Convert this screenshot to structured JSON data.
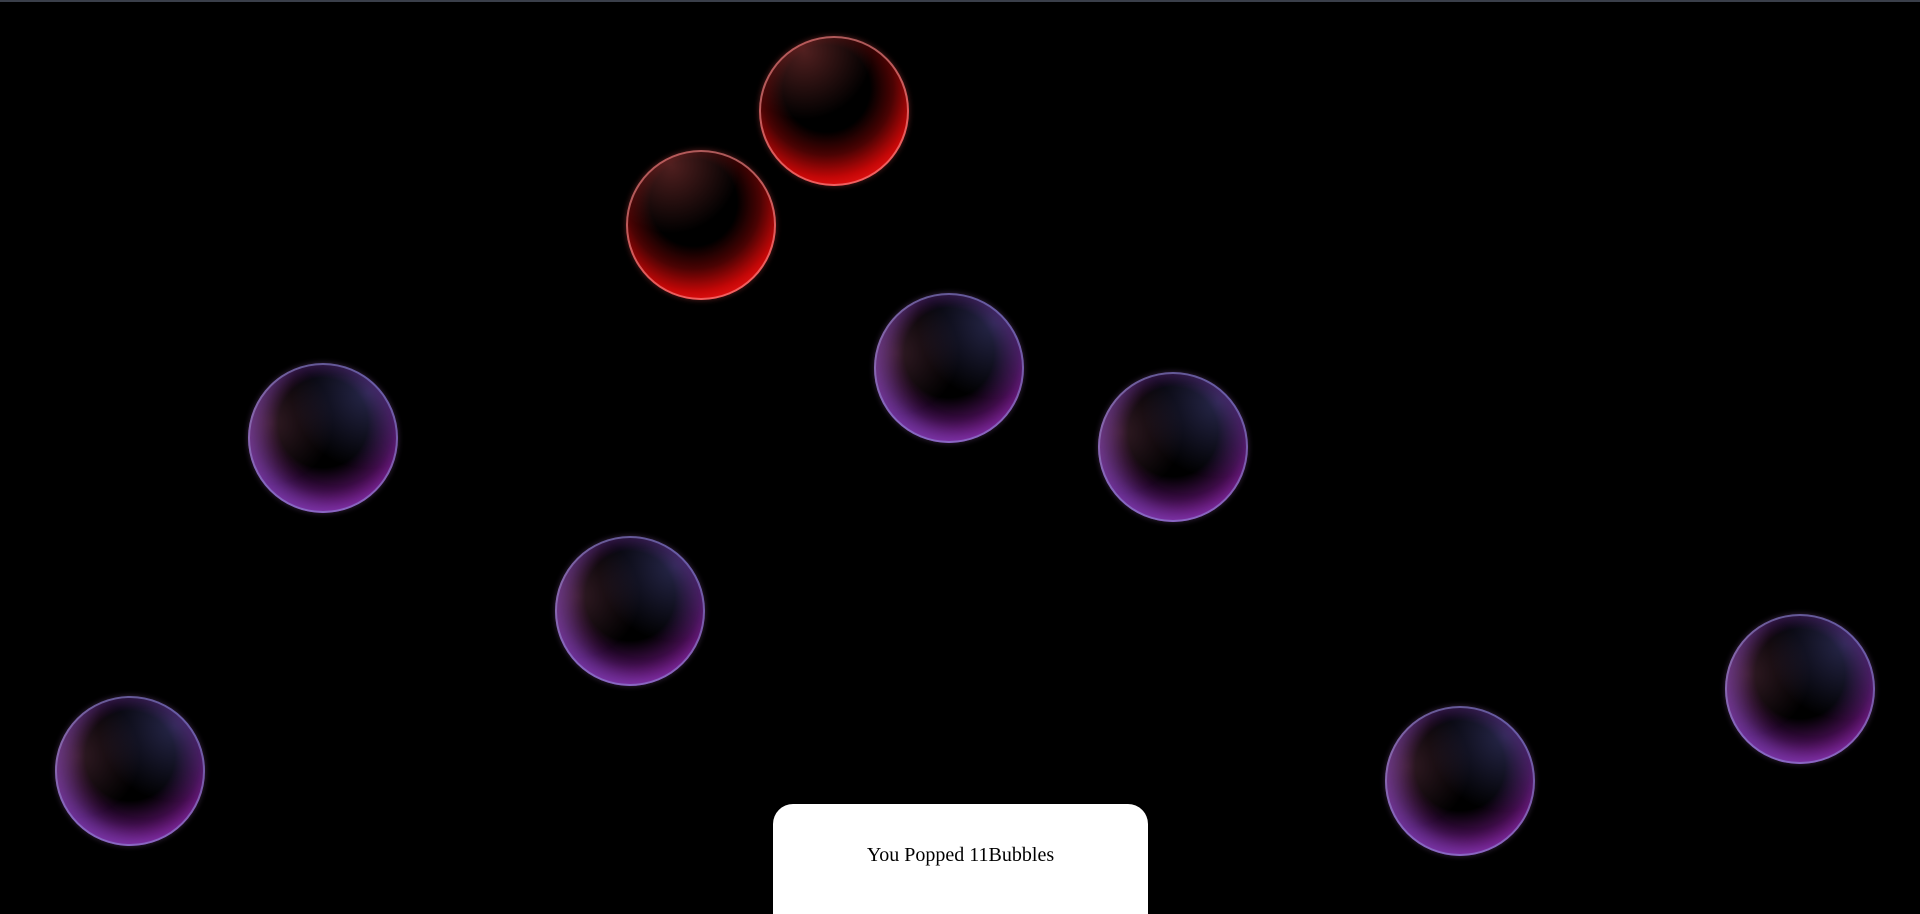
{
  "game": {
    "score_text": "You Popped 11Bubbles",
    "popped_count": 11,
    "colors": {
      "background": "#000000",
      "bubble_purple_rim": "#d96ad8",
      "bubble_red_rim": "#ff1a1a",
      "score_panel": "#ffffff"
    },
    "bubbles": [
      {
        "color": "red"
      },
      {
        "color": "red"
      },
      {
        "color": "purple"
      },
      {
        "color": "purple"
      },
      {
        "color": "purple"
      },
      {
        "color": "purple"
      },
      {
        "color": "purple"
      },
      {
        "color": "purple"
      },
      {
        "color": "purple"
      }
    ]
  }
}
